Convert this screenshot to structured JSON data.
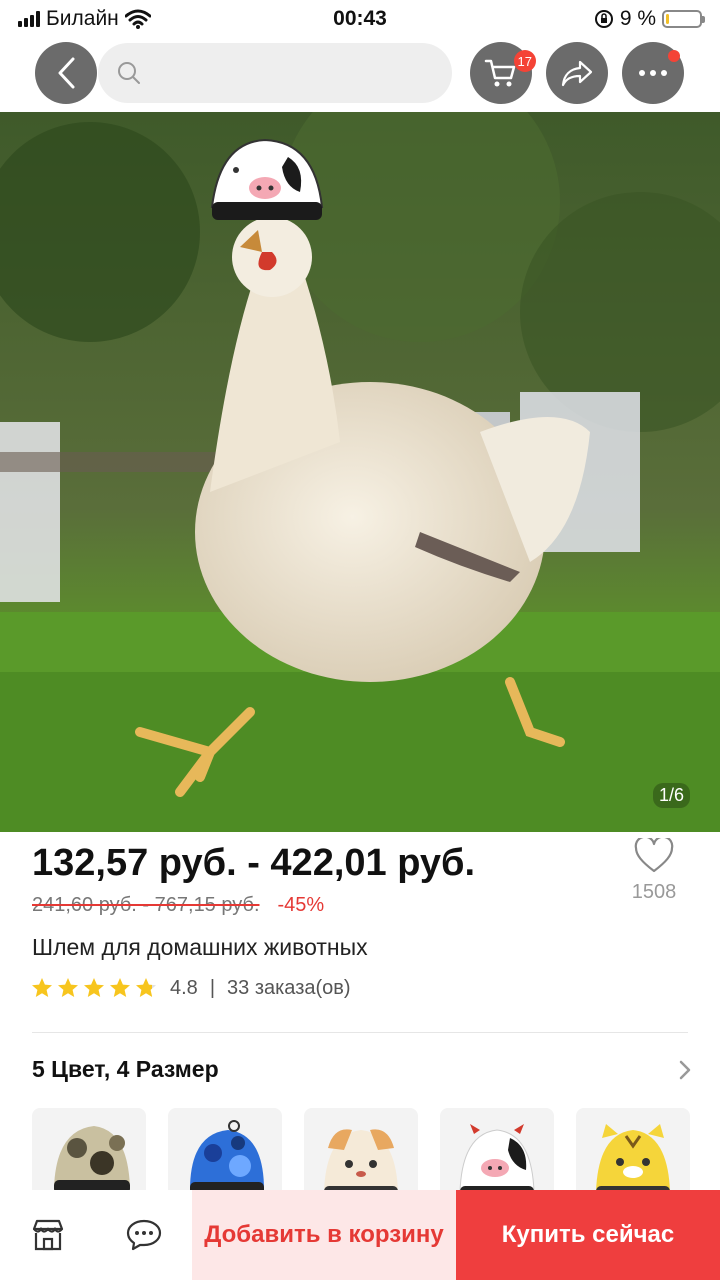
{
  "status_bar": {
    "carrier": "Билайн",
    "time": "00:43",
    "battery_percent": "9 %",
    "battery_level": 0.09
  },
  "top_nav": {
    "cart_badge": "17",
    "search_placeholder": ""
  },
  "product": {
    "image_counter": "1/6",
    "price_range": "132,57 руб. - 422,01 руб.",
    "old_price_range": "241,60 руб. - 767,15 руб.",
    "discount": "-45%",
    "wishlist_count": "1508",
    "title": "Шлем для домашних животных",
    "rating": "4.8",
    "rating_stars": 4.8,
    "orders": "33 заказа(ов)"
  },
  "variants": {
    "title": "5 Цвет, 4 Размер",
    "thumbnails": [
      {
        "name": "camo-helmet",
        "color": "#8a8060"
      },
      {
        "name": "blue-camo-helmet",
        "color": "#2d6fd8"
      },
      {
        "name": "dog-helmet",
        "color": "#e8b070"
      },
      {
        "name": "cow-helmet",
        "color": "#ffffff"
      },
      {
        "name": "tiger-helmet",
        "color": "#f5d53a"
      }
    ]
  },
  "bottom_bar": {
    "add_to_cart": "Добавить в корзину",
    "buy_now": "Купить сейчас"
  },
  "colors": {
    "accent_red": "#ef3e3e",
    "badge_red": "#f44336",
    "star_yellow": "#f7c51e"
  }
}
